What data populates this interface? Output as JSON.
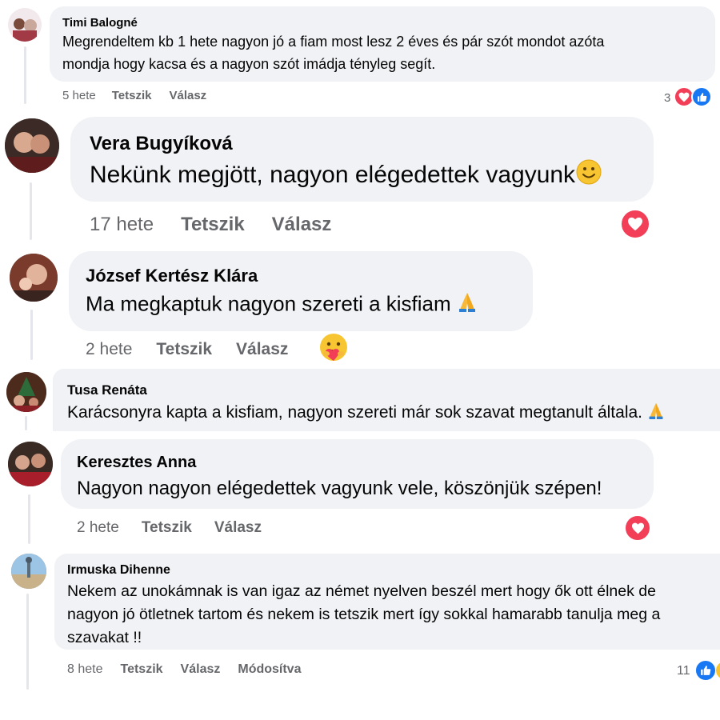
{
  "colors": {
    "bubble": "#f0f2f5",
    "meta": "#65676b",
    "heart": "#f33e58",
    "like": "#1877f2",
    "thread": "#e4e6eb"
  },
  "comments": [
    {
      "author": "Timi Balogné",
      "lines": [
        "Megrendeltem kb 1 hete nagyon jó a fiam most lesz 2 éves és pár szót mondot azóta",
        "mondja hogy kacsa és a nagyon szót imádja tényleg segít."
      ],
      "time": "5 hete",
      "like": "Tetszik",
      "reply": "Válasz",
      "reaction_count": "3",
      "reactions": [
        "heart-icon",
        "like-icon"
      ]
    },
    {
      "author": "Vera Bugyíková",
      "lines": [
        "Nekünk megjött, nagyon elégedettek vagyunk"
      ],
      "time": "17 hete",
      "like": "Tetszik",
      "reply": "Válasz",
      "reactions": [
        "heart-icon"
      ]
    },
    {
      "author": "József Kertész Klára",
      "lines": [
        "Ma megkaptuk nagyon szereti a kisfiam"
      ],
      "time": "2 hete",
      "like": "Tetszik",
      "reply": "Válasz",
      "reactions": [
        "care-emoji-icon"
      ]
    },
    {
      "author": "Tusa Renáta",
      "lines": [
        "Karácsonyra kapta a kisfiam, nagyon szereti már sok szavat megtanult általa."
      ]
    },
    {
      "author": "Keresztes Anna",
      "lines": [
        "Nagyon nagyon elégedettek vagyunk vele, köszönjük szépen!"
      ],
      "time": "2 hete",
      "like": "Tetszik",
      "reply": "Válasz",
      "reactions": [
        "heart-icon"
      ]
    },
    {
      "author": "Irmuska Dihenne",
      "lines": [
        "Nekem az unokámnak is van igaz az német nyelven beszél mert hogy ők ott élnek de",
        "nagyon jó ötletnek tartom és nekem is tetszik mert így sokkal hamarabb tanulja meg a",
        "szavakat !!"
      ],
      "time": "8 hete",
      "like": "Tetszik",
      "reply": "Válasz",
      "edited": "Módosítva",
      "reaction_count": "11",
      "reactions": [
        "like-icon",
        "haha-icon"
      ]
    }
  ]
}
